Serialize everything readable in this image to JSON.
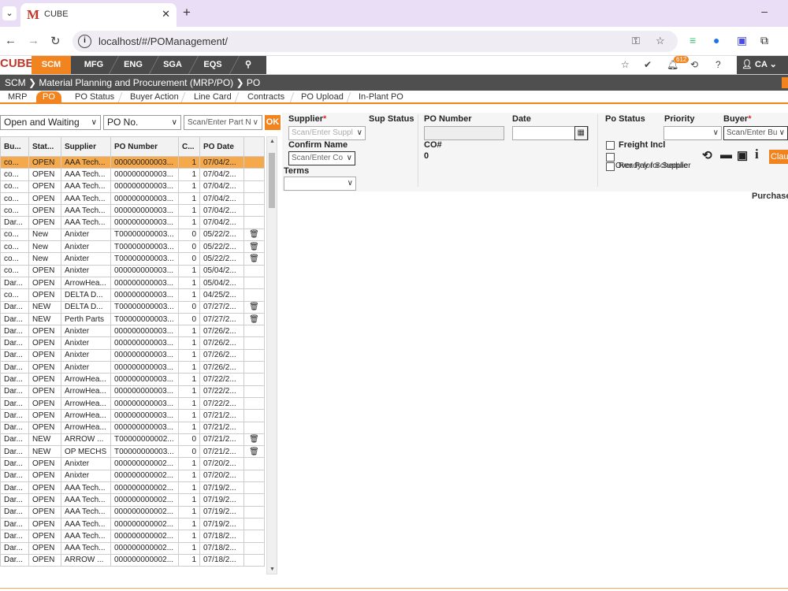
{
  "browser": {
    "tab_title": "CUBE",
    "favicon": "M",
    "url": "localhost/#/POManagement/"
  },
  "app": {
    "logo": "CUBE",
    "modules": [
      "SCM",
      "MFG",
      "ENG",
      "SGA",
      "EQS"
    ],
    "active_module": "SCM",
    "notif_count": "612",
    "user": "CA"
  },
  "breadcrumb": "SCM ❯ Material Planning and Procurement (MRP/PO) ❯ PO",
  "subtabs": [
    "MRP",
    "PO",
    "PO Status",
    "Buyer Action",
    "Line Card",
    "Contracts",
    "PO Upload",
    "In-Plant PO"
  ],
  "filters": {
    "status": "Open and Waiting",
    "search_by": "PO No.",
    "part_placeholder": "Scan/Enter Part N",
    "ok": "OK"
  },
  "grid": {
    "headers": [
      "Bu...",
      "Stat...",
      "Supplier",
      "PO Number",
      "C...",
      "PO Date"
    ],
    "rows": [
      [
        "co...",
        "OPEN",
        "AAA Tech...",
        "000000000003...",
        "1",
        "07/04/2...",
        ""
      ],
      [
        "co...",
        "OPEN",
        "AAA Tech...",
        "000000000003...",
        "1",
        "07/04/2...",
        ""
      ],
      [
        "co...",
        "OPEN",
        "AAA Tech...",
        "000000000003...",
        "1",
        "07/04/2...",
        ""
      ],
      [
        "co...",
        "OPEN",
        "AAA Tech...",
        "000000000003...",
        "1",
        "07/04/2...",
        ""
      ],
      [
        "co...",
        "OPEN",
        "AAA Tech...",
        "000000000003...",
        "1",
        "07/04/2...",
        ""
      ],
      [
        "Dar...",
        "OPEN",
        "AAA Tech...",
        "000000000003...",
        "1",
        "07/04/2...",
        ""
      ],
      [
        "co...",
        "New",
        "Anixter",
        "T00000000003...",
        "0",
        "05/22/2...",
        "trash"
      ],
      [
        "co...",
        "New",
        "Anixter",
        "T00000000003...",
        "0",
        "05/22/2...",
        "trash"
      ],
      [
        "co...",
        "New",
        "Anixter",
        "T00000000003...",
        "0",
        "05/22/2...",
        "trash"
      ],
      [
        "co...",
        "OPEN",
        "Anixter",
        "000000000003...",
        "1",
        "05/04/2...",
        ""
      ],
      [
        "Dar...",
        "OPEN",
        "ArrowHea...",
        "000000000003...",
        "1",
        "05/04/2...",
        ""
      ],
      [
        "co...",
        "OPEN",
        "DELTA D...",
        "000000000003...",
        "1",
        "04/25/2...",
        ""
      ],
      [
        "Dar...",
        "NEW",
        "DELTA D...",
        "T00000000003...",
        "0",
        "07/27/2...",
        "trash"
      ],
      [
        "Dar...",
        "NEW",
        "Perth Parts",
        "T00000000003...",
        "0",
        "07/27/2...",
        "trash"
      ],
      [
        "Dar...",
        "OPEN",
        "Anixter",
        "000000000003...",
        "1",
        "07/26/2...",
        ""
      ],
      [
        "Dar...",
        "OPEN",
        "Anixter",
        "000000000003...",
        "1",
        "07/26/2...",
        ""
      ],
      [
        "Dar...",
        "OPEN",
        "Anixter",
        "000000000003...",
        "1",
        "07/26/2...",
        ""
      ],
      [
        "Dar...",
        "OPEN",
        "Anixter",
        "000000000003...",
        "1",
        "07/26/2...",
        ""
      ],
      [
        "Dar...",
        "OPEN",
        "ArrowHea...",
        "000000000003...",
        "1",
        "07/22/2...",
        ""
      ],
      [
        "Dar...",
        "OPEN",
        "ArrowHea...",
        "000000000003...",
        "1",
        "07/22/2...",
        ""
      ],
      [
        "Dar...",
        "OPEN",
        "ArrowHea...",
        "000000000003...",
        "1",
        "07/22/2...",
        ""
      ],
      [
        "Dar...",
        "OPEN",
        "ArrowHea...",
        "000000000003...",
        "1",
        "07/21/2...",
        ""
      ],
      [
        "Dar...",
        "OPEN",
        "ArrowHea...",
        "000000000003...",
        "1",
        "07/21/2...",
        ""
      ],
      [
        "Dar...",
        "NEW",
        "ARROW ...",
        "T00000000002...",
        "0",
        "07/21/2...",
        "trash"
      ],
      [
        "Dar...",
        "NEW",
        "OP MECHS",
        "T00000000003...",
        "0",
        "07/21/2...",
        "trash"
      ],
      [
        "Dar...",
        "OPEN",
        "Anixter",
        "000000000002...",
        "1",
        "07/20/2...",
        ""
      ],
      [
        "Dar...",
        "OPEN",
        "Anixter",
        "000000000002...",
        "1",
        "07/20/2...",
        ""
      ],
      [
        "Dar...",
        "OPEN",
        "AAA Tech...",
        "000000000002...",
        "1",
        "07/19/2...",
        ""
      ],
      [
        "Dar...",
        "OPEN",
        "AAA Tech...",
        "000000000002...",
        "1",
        "07/19/2...",
        ""
      ],
      [
        "Dar...",
        "OPEN",
        "AAA Tech...",
        "000000000002...",
        "1",
        "07/19/2...",
        ""
      ],
      [
        "Dar...",
        "OPEN",
        "AAA Tech...",
        "000000000002...",
        "1",
        "07/19/2...",
        ""
      ],
      [
        "Dar...",
        "OPEN",
        "AAA Tech...",
        "000000000002...",
        "1",
        "07/18/2...",
        ""
      ],
      [
        "Dar...",
        "OPEN",
        "AAA Tech...",
        "000000000002...",
        "1",
        "07/18/2...",
        ""
      ],
      [
        "Dar...",
        "OPEN",
        "ARROW ...",
        "000000000002...",
        "1",
        "07/18/2...",
        ""
      ]
    ]
  },
  "form": {
    "supplier_label": "Supplier",
    "supplier_placeholder": "Scan/Enter Suppl",
    "sup_status_label": "Sup Status",
    "confirm_name_label": "Confirm Name",
    "confirm_name_placeholder": "Scan/Enter Co",
    "terms_label": "Terms",
    "po_number_label": "PO Number",
    "co_label": "CO#",
    "co_value": "0",
    "date_label": "Date",
    "po_status_label": "Po Status",
    "priority_label": "Priority",
    "buyer_label": "Buyer",
    "buyer_placeholder": "Scan/Enter Bu",
    "freight_label": "Freight Incl",
    "ready_label": "Ready for Schedule",
    "overlap_label": "Over Pay for Supplier",
    "clau_button": "Clau",
    "purchase_label": "Purchase"
  }
}
